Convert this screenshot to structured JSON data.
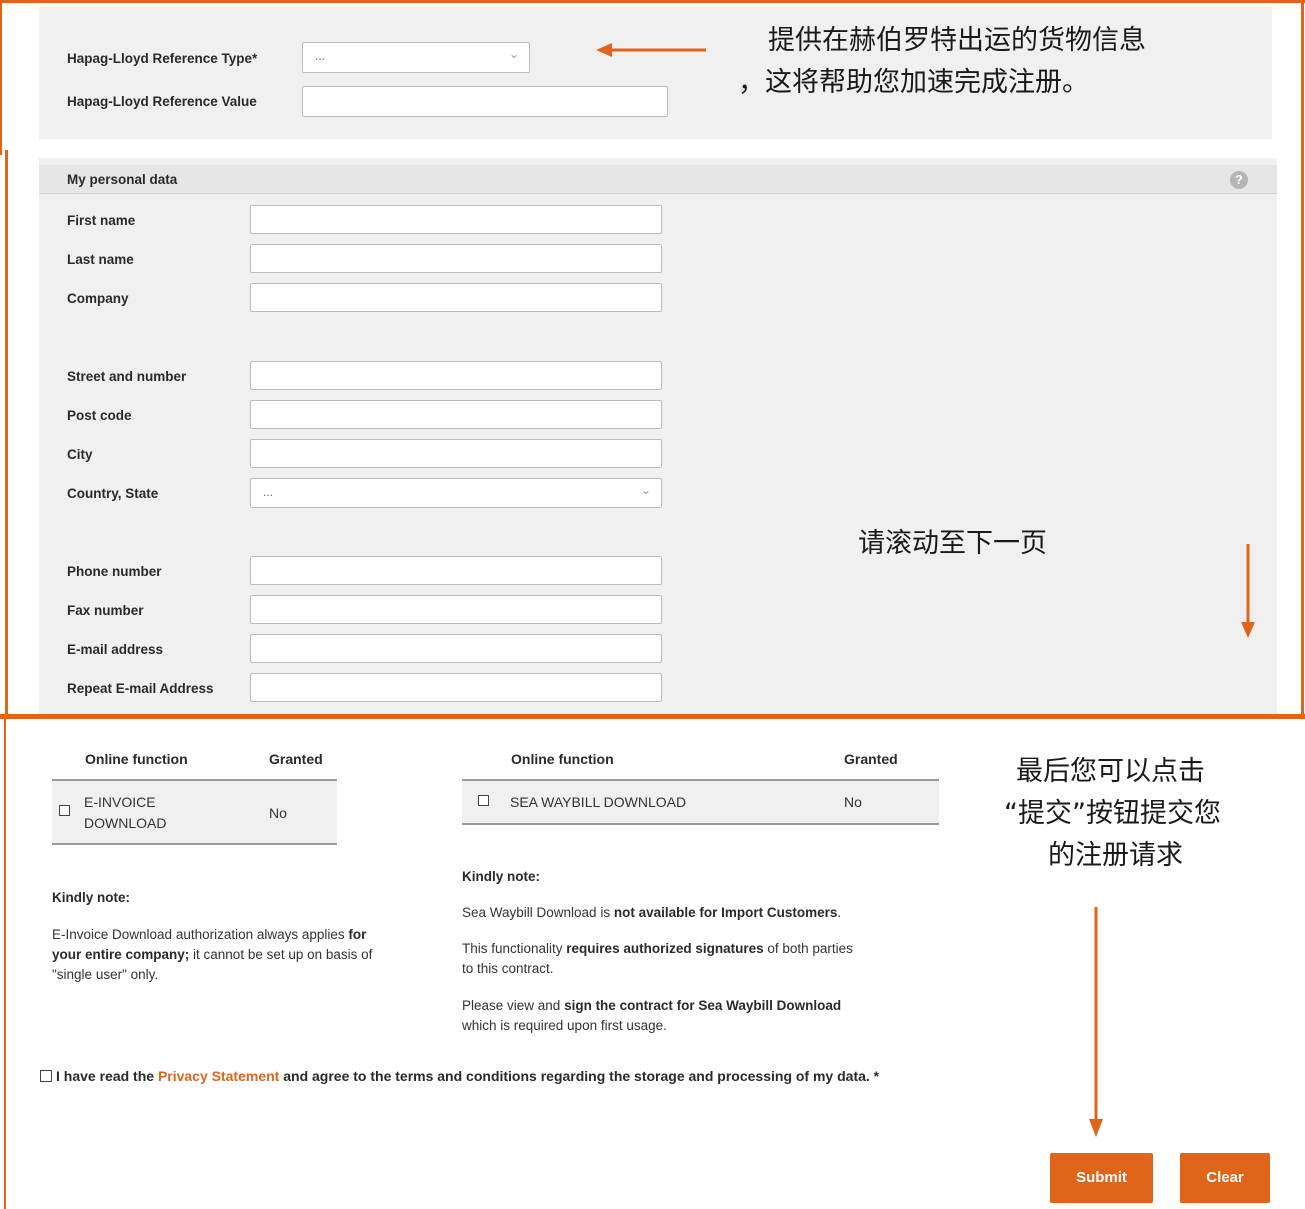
{
  "reference": {
    "type_label": "Hapag-Lloyd Reference Type*",
    "type_value": "...",
    "value_label": "Hapag-Lloyd Reference Value"
  },
  "annotations": {
    "top_line1": "提供在赫伯罗特出运的货物信息",
    "top_line2": "，这将帮助您加速完成注册。",
    "scroll_hint": "请滚动至下一页",
    "submit_line1": "最后您可以点击",
    "submit_line2": "“提交”按钮提交您",
    "submit_line3": "的注册请求"
  },
  "personal": {
    "header": "My personal data",
    "fields": {
      "first_name": "First name",
      "last_name": "Last name",
      "company": "Company",
      "street": "Street and number",
      "post_code": "Post code",
      "city": "City",
      "country": "Country, State",
      "country_value": "...",
      "phone": "Phone number",
      "fax": "Fax number",
      "email": "E-mail address",
      "repeat_email": "Repeat E-mail Address"
    }
  },
  "functions": {
    "left": {
      "col_function": "Online function",
      "col_granted": "Granted",
      "row_name_line1": "E-INVOICE",
      "row_name_line2": "DOWNLOAD",
      "row_granted": "No",
      "note_title": "Kindly note:",
      "note_p1_a": "E-Invoice Download authorization always applies ",
      "note_p1_b": "for",
      "note_p1_c": "your entire company;",
      "note_p1_d": " it cannot be set up on basis of",
      "note_p1_e": "\"single user\" only."
    },
    "right": {
      "col_function": "Online function",
      "col_granted": "Granted",
      "row_name": "SEA WAYBILL DOWNLOAD",
      "row_granted": "No",
      "note_title": "Kindly note:",
      "note_p1_a": "Sea Waybill Download is ",
      "note_p1_b": "not available for Import Customers",
      "note_p1_c": ".",
      "note_p2_a": "This functionality ",
      "note_p2_b": "requires authorized signatures",
      "note_p2_c": " of both parties",
      "note_p2_d": "to this contract.",
      "note_p3_a": "Please view and ",
      "note_p3_link": "sign the contract for Sea Waybill Download",
      "note_p3_b": "which is required upon first usage."
    }
  },
  "privacy": {
    "text_a": "I have read the ",
    "link": "Privacy Statement",
    "text_b": " and agree to the terms and conditions regarding the storage and processing of my data. *"
  },
  "buttons": {
    "submit": "Submit",
    "clear": "Clear"
  },
  "colors": {
    "accent": "#e0651b",
    "panel": "#f0f0f0"
  }
}
